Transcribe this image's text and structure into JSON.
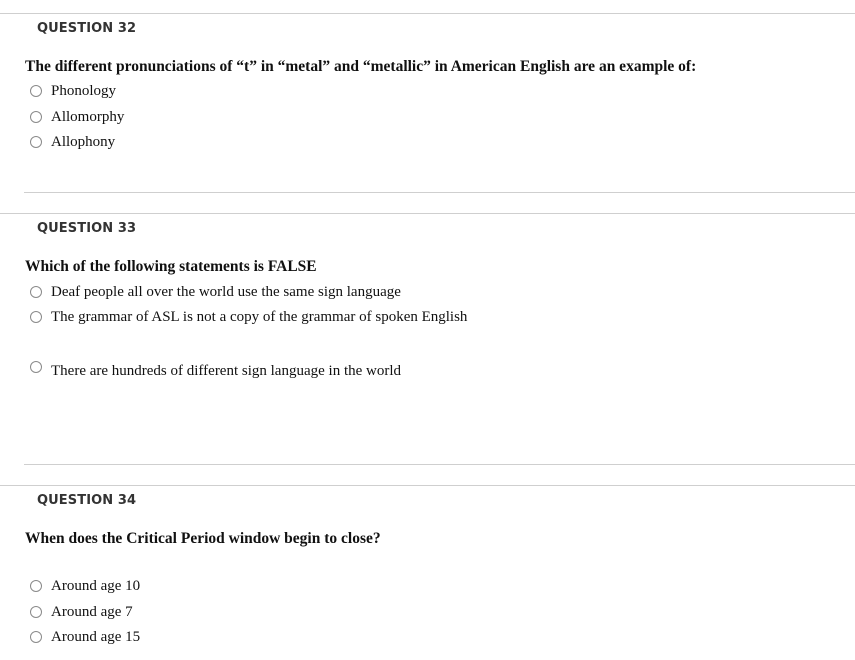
{
  "questions": [
    {
      "header": "QUESTION 32",
      "prompt": "The different pronunciations of “t” in “metal” and “metallic” in American English are an example of:",
      "options": [
        "Phonology",
        "Allomorphy",
        "Allophony"
      ]
    },
    {
      "header": "QUESTION 33",
      "prompt": "Which of the following statements is FALSE",
      "options": [
        "Deaf people all over the world use the same sign language",
        "The grammar of ASL is not a copy of the grammar of spoken English",
        "There are hundreds of different sign language in the world"
      ]
    },
    {
      "header": "QUESTION 34",
      "prompt": "When does the Critical Period window begin to close?",
      "options": [
        "Around age 10",
        "Around age 7",
        "Around age 15"
      ]
    }
  ]
}
